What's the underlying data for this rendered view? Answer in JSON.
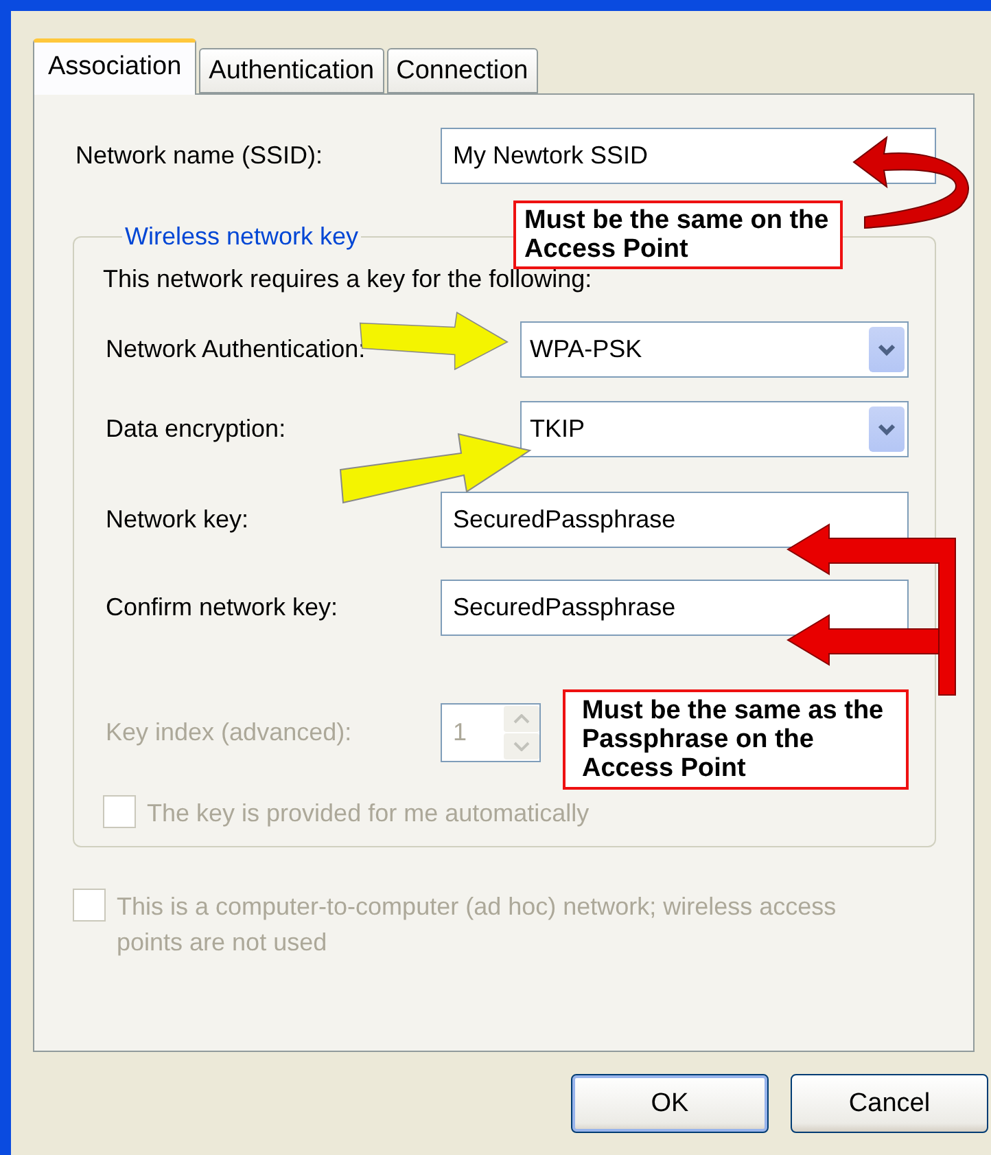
{
  "tabs": [
    {
      "label": "Association",
      "selected": true
    },
    {
      "label": "Authentication",
      "selected": false
    },
    {
      "label": "Connection",
      "selected": false
    }
  ],
  "ssid": {
    "label": "Network name (SSID):",
    "value": "My Newtork SSID"
  },
  "group": {
    "legend": "Wireless network key",
    "instruction": "This network requires a key for the following:",
    "rows": [
      {
        "kind": "combo",
        "label": "Network Authentication:",
        "value": "WPA-PSK",
        "disabled": false
      },
      {
        "kind": "combo",
        "label": "Data encryption:",
        "value": "TKIP",
        "disabled": false
      },
      {
        "kind": "text",
        "label": "Network key:",
        "value": "SecuredPassphrase",
        "disabled": false
      },
      {
        "kind": "text",
        "label": "Confirm network key:",
        "value": "SecuredPassphrase",
        "disabled": false
      },
      {
        "kind": "spin",
        "label": "Key index (advanced):",
        "value": "1",
        "disabled": true
      }
    ],
    "checkbox": {
      "label": "The key is provided for me automatically",
      "checked": false,
      "disabled": true
    }
  },
  "adhoc": {
    "label": "This is a computer-to-computer (ad hoc) network; wireless access points are not used",
    "checked": false,
    "disabled": true
  },
  "buttons": [
    {
      "label": "OK",
      "default": true
    },
    {
      "label": "Cancel",
      "default": false
    }
  ],
  "callouts": [
    "Must be the same on the Access Point",
    "Must be the same as the Passphrase on the Access Point"
  ]
}
